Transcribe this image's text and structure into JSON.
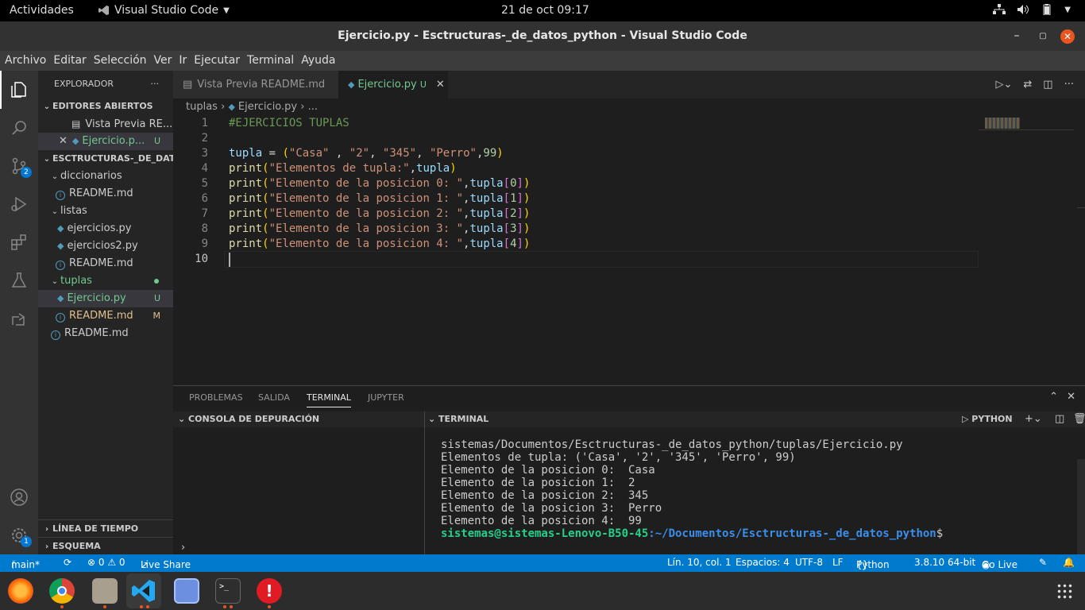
{
  "topbar": {
    "activities": "Actividades",
    "app": "Visual Studio Code",
    "clock": "21 de oct  09:17"
  },
  "window": {
    "title": "Ejercicio.py - Esctructuras-_de_datos_python - Visual Studio Code"
  },
  "menu": [
    "Archivo",
    "Editar",
    "Selección",
    "Ver",
    "Ir",
    "Ejecutar",
    "Terminal",
    "Ayuda"
  ],
  "activitybar": {
    "scm_badge": "2",
    "accounts_badge": "1"
  },
  "sidebar": {
    "title": "EXPLORADOR",
    "open_editors": "EDITORES ABIERTOS",
    "open1": "Vista Previa RE...",
    "open2": "Ejercicio.p...",
    "open2_badge": "U",
    "root": "ESCTRUCTURAS-_DE_DAT...",
    "items": [
      {
        "label": "diccionarios"
      },
      {
        "label": "README.md"
      },
      {
        "label": "listas"
      },
      {
        "label": "ejercicios.py"
      },
      {
        "label": "ejercicios2.py"
      },
      {
        "label": "README.md"
      },
      {
        "label": "tuplas"
      },
      {
        "label": "Ejercicio.py",
        "badge": "U"
      },
      {
        "label": "README.md",
        "badge": "M"
      },
      {
        "label": "README.md"
      }
    ],
    "timeline": "LÍNEA DE TIEMPO",
    "outline": "ESQUEMA"
  },
  "tabs": {
    "tab1": "Vista Previa README.md",
    "tab2": "Ejercicio.py",
    "tab2_badge": "U"
  },
  "breadcrumb": {
    "folder": "tuplas",
    "file": "Ejercicio.py",
    "more": "..."
  },
  "code_lines": [
    "1",
    "2",
    "3",
    "4",
    "5",
    "6",
    "7",
    "8",
    "9",
    "10"
  ],
  "code": {
    "l1": "#EJERCICIOS TUPLAS",
    "l3a": "tupla",
    "l3b": " = ",
    "l3c": "(",
    "l3d": "\"Casa\"",
    "l3e": " , ",
    "l3f": "\"2\"",
    "l3g": ", ",
    "l3h": "\"345\"",
    "l3i": ", ",
    "l3j": "\"Perro\"",
    "l3k": ",",
    "l3l": "99",
    "l3m": ")",
    "print": "print",
    "l4s": "\"Elementos de tupla:\"",
    "tupla": "tupla",
    "l5s": "\"Elemento de la posicion 0: \"",
    "l6s": "\"Elemento de la posicion 1: \"",
    "l7s": "\"Elemento de la posicion 2: \"",
    "l8s": "\"Elemento de la posicion 3: \"",
    "l9s": "\"Elemento de la posicion 4: \"",
    "i0": "0",
    "i1": "1",
    "i2": "2",
    "i3": "3",
    "i4": "4"
  },
  "panel": {
    "tabs": [
      "PROBLEMAS",
      "SALIDA",
      "TERMINAL",
      "JUPYTER"
    ],
    "debug_console": "CONSOLA DE DEPURACIÓN",
    "terminal_label": "TERMINAL",
    "shell": "PYTHON",
    "terminal_lines": [
      "sistemas/Documentos/Esctructuras-_de_datos_python/tuplas/Ejercicio.py",
      "Elementos de tupla: ('Casa', '2', '345', 'Perro', 99)",
      "Elemento de la posicion 0:  Casa",
      "Elemento de la posicion 1:  2",
      "Elemento de la posicion 2:  345",
      "Elemento de la posicion 3:  Perro",
      "Elemento de la posicion 4:  99"
    ],
    "prompt_user": "sistemas@sistemas-Lenovo-B50-45",
    "prompt_path": ":~/Documentos/Esctructuras-_de_datos_python",
    "prompt_end": "$"
  },
  "status": {
    "branch": "main*",
    "errors": "⊗ 0 ⚠ 0",
    "liveshare": "Live Share",
    "position": "Lín. 10, col. 1",
    "spaces": "Espacios: 4",
    "encoding": "UTF-8",
    "eol": "LF",
    "language": "Python",
    "interpreter": "3.8.10 64-bit",
    "golive": "Go Live"
  },
  "colors": {
    "accent": "#007acc",
    "activity": "#333333",
    "sidebar": "#252526",
    "editor": "#1e1e1e"
  }
}
